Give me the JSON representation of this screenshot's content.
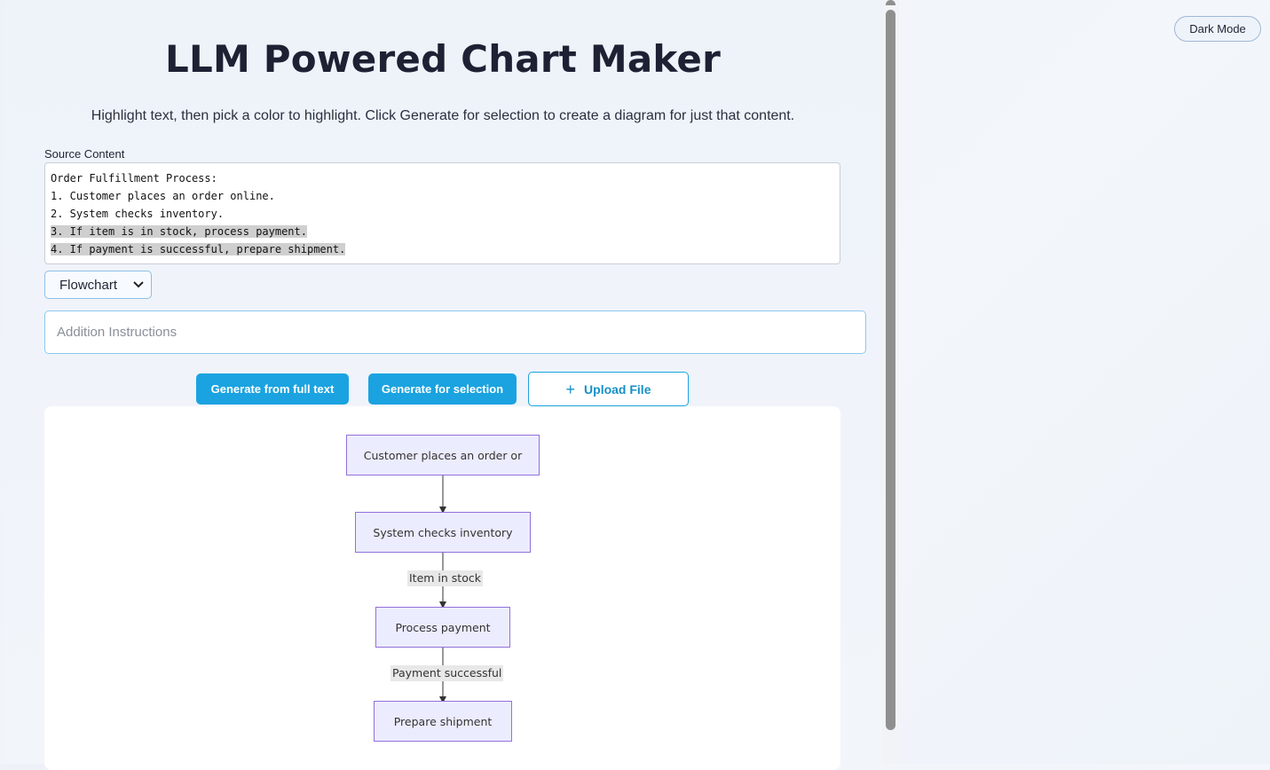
{
  "header": {
    "title": "LLM Powered Chart Maker",
    "subtitle": "Highlight text, then pick a color to highlight. Click Generate for selection to create a diagram for just that content.",
    "dark_mode_label": "Dark Mode"
  },
  "source": {
    "label": "Source Content",
    "lines": [
      "Order Fulfillment Process:",
      "1. Customer places an order online.",
      "2. System checks inventory.",
      "3. If item is in stock, process payment.",
      "4. If payment is successful, prepare shipment."
    ]
  },
  "chart_type": {
    "selected": "Flowchart"
  },
  "instructions": {
    "placeholder": "Addition Instructions",
    "value": ""
  },
  "actions": {
    "generate_full": "Generate from full text",
    "generate_selection": "Generate for selection",
    "upload": "Upload File"
  },
  "diagram": {
    "nodes": [
      "Customer places an order or",
      "System checks inventory",
      "Process payment",
      "Prepare shipment"
    ],
    "edge_labels": [
      "Item in stock",
      "Payment successful"
    ]
  },
  "colors": {
    "accent": "#1aa3e0",
    "node_fill": "#ececff",
    "node_border": "#9370db",
    "highlight": "#cfcfcf"
  },
  "icons": {
    "upload": "plus-icon",
    "select": "chevron-down-icon"
  }
}
